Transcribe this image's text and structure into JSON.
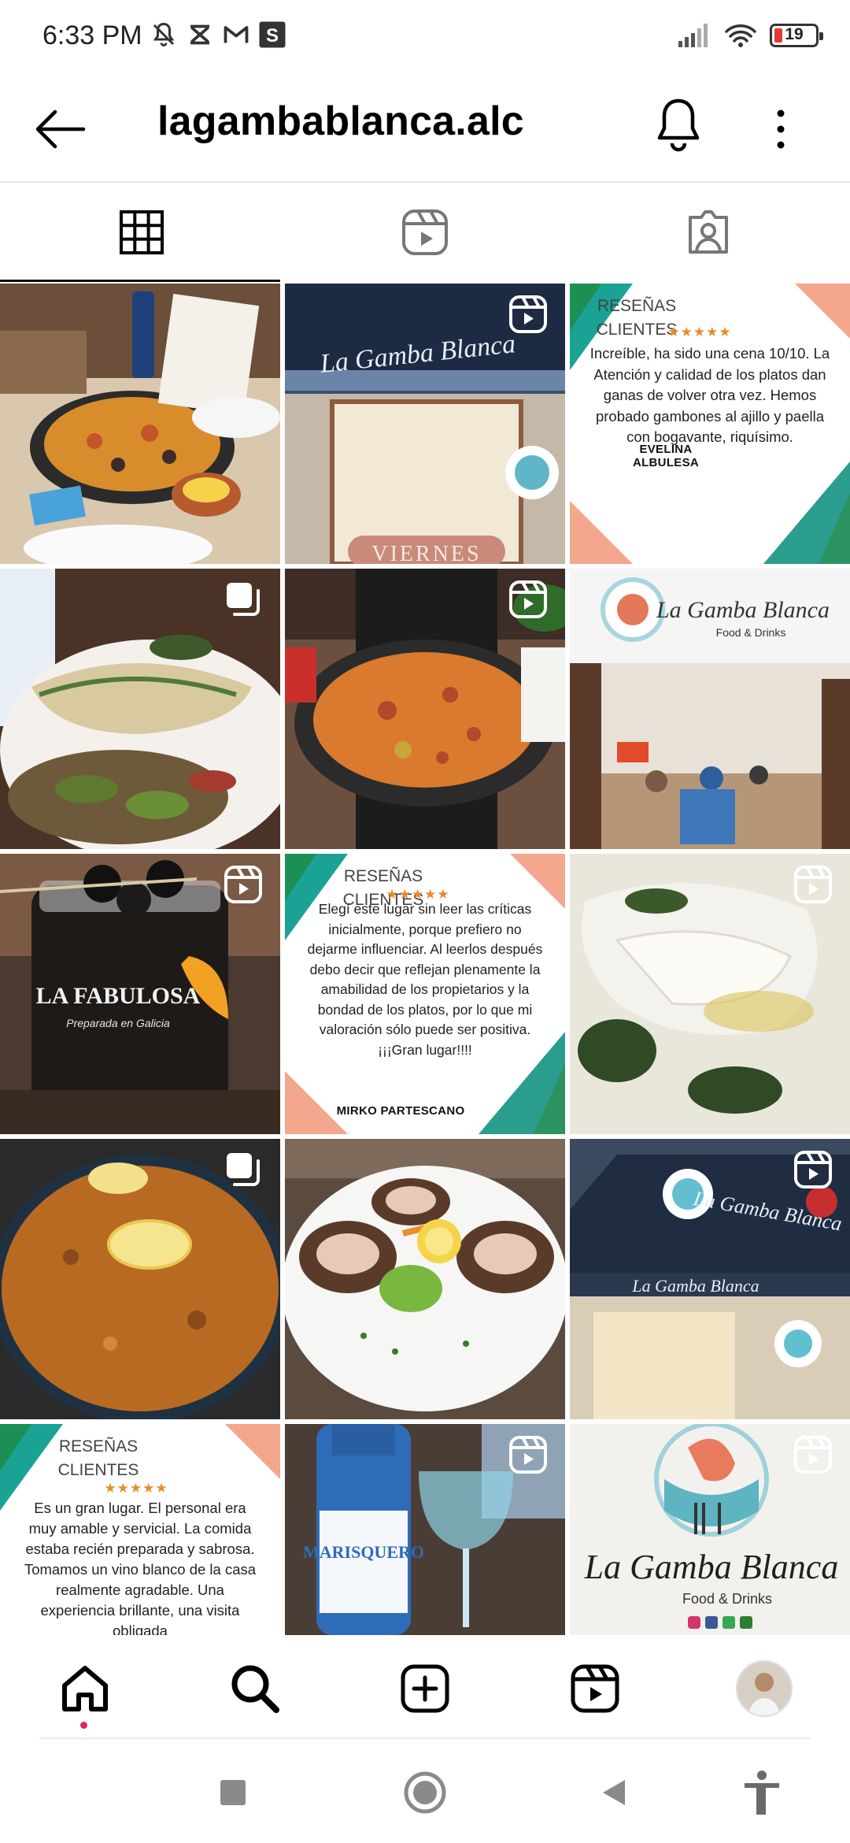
{
  "status_bar": {
    "time": "6:33 PM",
    "left_icons": [
      "muted-bell-icon",
      "capcut-icon",
      "gmail-icon",
      "s-app-icon"
    ],
    "right_icons": [
      "signal-icon",
      "wifi-icon"
    ],
    "battery_level": "19",
    "battery_fraction": 0.19,
    "battery_color": "#e53935"
  },
  "header": {
    "username": "lagambablanca.alc",
    "back_icon": "arrow-left-icon",
    "bell_icon": "bell-icon",
    "more_icon": "more-vertical-icon"
  },
  "tabs": [
    {
      "icon": "grid-icon",
      "active": true
    },
    {
      "icon": "reels-icon",
      "active": false
    },
    {
      "icon": "tagged-icon",
      "active": false
    }
  ],
  "grid": {
    "posts": [
      {
        "kind": "photo",
        "badge": "",
        "subject": "paella-table"
      },
      {
        "kind": "photo",
        "badge": "reel",
        "subject": "storefront-sign",
        "overlay_text": "VIERNES"
      },
      {
        "kind": "review",
        "badge": "",
        "heading_line1": "RESEÑAS",
        "heading_line2": "CLIENTES",
        "stars": "★★★★★",
        "body": "Increíble, ha sido una cena 10/10. La Atención y calidad de los platos dan ganas de volver otra vez. Hemos probado gambones al ajillo y paella con bogavante, riquísimo.",
        "author": "EVELINA ALBULESA"
      },
      {
        "kind": "photo",
        "badge": "multi",
        "subject": "fish-plate"
      },
      {
        "kind": "photo",
        "badge": "reel",
        "subject": "paella-held"
      },
      {
        "kind": "photo",
        "badge": "",
        "subject": "restaurant-interior",
        "overlay_text": "La Gamba Blanca",
        "overlay_sub": "Food & Drinks"
      },
      {
        "kind": "photo",
        "badge": "reel",
        "subject": "sangria-jar",
        "overlay_text": "LA FABULOSA"
      },
      {
        "kind": "review",
        "badge": "",
        "heading_line1": "RESEÑAS",
        "heading_line2": "CLIENTES",
        "stars": "★★★★★",
        "body": "Elegí este lugar sin leer las críticas inicialmente, porque prefiero no dejarme influenciar. Al leerlos después debo decir que reflejan plenamente la amabilidad de los propietarios y la bondad de los platos, por lo que mi valoración sólo puede ser positiva. ¡¡¡Gran lugar!!!!",
        "author": "MIRKO PARTESCANO"
      },
      {
        "kind": "photo",
        "badge": "reel",
        "subject": "squid-dish"
      },
      {
        "kind": "photo",
        "badge": "multi",
        "subject": "rice-lemon"
      },
      {
        "kind": "photo",
        "badge": "",
        "subject": "scallops"
      },
      {
        "kind": "photo",
        "badge": "reel",
        "subject": "awning-exterior"
      },
      {
        "kind": "review",
        "badge": "",
        "heading_line1": "RESEÑAS",
        "heading_line2": "CLIENTES",
        "stars": "★★★★★",
        "body": "Es un gran lugar. El personal era muy amable y servicial. La comida estaba recién preparada y sabrosa. Tomamos un vino blanco de la casa realmente agradable. Una experiencia brillante, una visita obligada",
        "author": ""
      },
      {
        "kind": "photo",
        "badge": "reel",
        "subject": "blue-wine",
        "overlay_text": "MARISQUERO"
      },
      {
        "kind": "photo",
        "badge": "reel",
        "subject": "logo",
        "overlay_text": "La Gamba Blanca",
        "overlay_sub": "Food & Drinks"
      }
    ]
  },
  "bottom_nav": {
    "items": [
      "home-icon",
      "search-icon",
      "create-icon",
      "reels-nav-icon",
      "profile-avatar"
    ],
    "home_notification_color": "#e0245e"
  },
  "system_nav": [
    "recents-icon",
    "home-circle-icon",
    "back-triangle-icon",
    "accessibility-icon"
  ]
}
